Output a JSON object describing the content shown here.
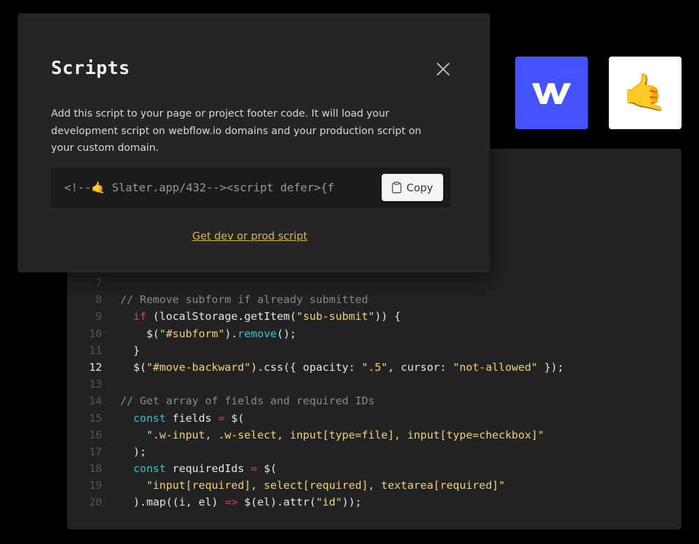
{
  "modal": {
    "title": "Scripts",
    "description": "Add this script to your page or project footer code. It will load your development script on webflow.io domains and your production script on your custom domain.",
    "snippet": "<!--🤙 Slater.app/432--><script defer>{f",
    "copy_label": "Copy",
    "link_label": "Get dev or prod script"
  },
  "tiles": {
    "webflow_letter": "W",
    "slater_emoji": "🤙"
  },
  "editor": {
    "active_line": "12",
    "lines": [
      {
        "num": "7",
        "tokens": []
      },
      {
        "num": "8",
        "tokens": [
          {
            "t": "// Remove subform if already submitted",
            "c": "comment"
          }
        ]
      },
      {
        "num": "9",
        "tokens": [
          {
            "t": "  ",
            "c": "plain"
          },
          {
            "t": "if",
            "c": "keyword"
          },
          {
            "t": " (localStorage.getItem(",
            "c": "plain"
          },
          {
            "t": "\"sub-submit\"",
            "c": "string"
          },
          {
            "t": ")) {",
            "c": "plain"
          }
        ]
      },
      {
        "num": "10",
        "tokens": [
          {
            "t": "    $(",
            "c": "plain"
          },
          {
            "t": "\"#subform\"",
            "c": "string"
          },
          {
            "t": ").",
            "c": "plain"
          },
          {
            "t": "remove",
            "c": "method"
          },
          {
            "t": "();",
            "c": "plain"
          }
        ]
      },
      {
        "num": "11",
        "tokens": [
          {
            "t": "  }",
            "c": "plain"
          }
        ]
      },
      {
        "num": "12",
        "tokens": [
          {
            "t": "  $(",
            "c": "plain"
          },
          {
            "t": "\"#move-backward\"",
            "c": "string"
          },
          {
            "t": ").css({ opacity: ",
            "c": "plain"
          },
          {
            "t": "\".5\"",
            "c": "string"
          },
          {
            "t": ", cursor: ",
            "c": "plain"
          },
          {
            "t": "\"not-allowed\"",
            "c": "string"
          },
          {
            "t": " });",
            "c": "plain"
          }
        ]
      },
      {
        "num": "13",
        "tokens": []
      },
      {
        "num": "14",
        "tokens": [
          {
            "t": "// Get array of fields and required IDs",
            "c": "comment"
          }
        ]
      },
      {
        "num": "15",
        "tokens": [
          {
            "t": "  ",
            "c": "plain"
          },
          {
            "t": "const",
            "c": "declare"
          },
          {
            "t": " fields ",
            "c": "plain"
          },
          {
            "t": "=",
            "c": "op"
          },
          {
            "t": " $(",
            "c": "plain"
          }
        ]
      },
      {
        "num": "16",
        "tokens": [
          {
            "t": "    ",
            "c": "plain"
          },
          {
            "t": "\".w-input, .w-select, input[type=file], input[type=checkbox]\"",
            "c": "string"
          }
        ]
      },
      {
        "num": "17",
        "tokens": [
          {
            "t": "  );",
            "c": "plain"
          }
        ]
      },
      {
        "num": "18",
        "tokens": [
          {
            "t": "  ",
            "c": "plain"
          },
          {
            "t": "const",
            "c": "declare"
          },
          {
            "t": " requiredIds ",
            "c": "plain"
          },
          {
            "t": "=",
            "c": "op"
          },
          {
            "t": " $(",
            "c": "plain"
          }
        ]
      },
      {
        "num": "19",
        "tokens": [
          {
            "t": "    ",
            "c": "plain"
          },
          {
            "t": "\"input[required], select[required], textarea[required]\"",
            "c": "string"
          }
        ]
      },
      {
        "num": "20",
        "tokens": [
          {
            "t": "  ).map((i, el) ",
            "c": "plain"
          },
          {
            "t": "=>",
            "c": "op"
          },
          {
            "t": " $(el).attr(",
            "c": "plain"
          },
          {
            "t": "\"id\"",
            "c": "string"
          },
          {
            "t": "));",
            "c": "plain"
          }
        ]
      }
    ]
  },
  "icons": {
    "close": "close-icon",
    "clipboard": "clipboard-icon",
    "webflow": "webflow-logo",
    "slater": "call-me-hand-emoji"
  },
  "colors": {
    "webflow_blue": "#4353ff",
    "link_yellow": "#d9b84f",
    "keyword_pink": "#e0377d",
    "declare_cyan": "#2ec5d3",
    "string_yellow": "#f2d46b"
  }
}
